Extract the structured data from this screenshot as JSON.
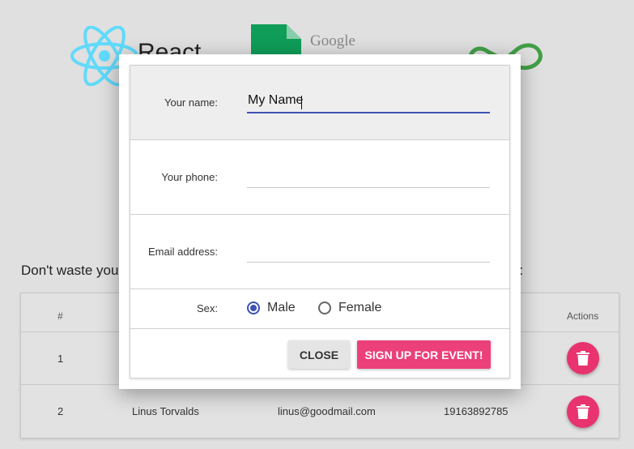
{
  "background": {
    "logos": {
      "react_text": "React",
      "google_text": "Google"
    },
    "intro_text_left": "Don't waste you",
    "intro_text_right": "n:",
    "table": {
      "headers": {
        "number": "#",
        "actions": "Actions"
      },
      "rows": [
        {
          "number": "1",
          "name": "",
          "email": "",
          "phone": ""
        },
        {
          "number": "2",
          "name": "Linus Torvalds",
          "email": "linus@goodmail.com",
          "phone": "19163892785"
        }
      ]
    },
    "delete_icon": "trash-icon"
  },
  "dialog": {
    "fields": {
      "name": {
        "label": "Your name:",
        "value": "My Name",
        "placeholder": ""
      },
      "phone": {
        "label": "Your phone:",
        "value": "",
        "placeholder": ""
      },
      "email": {
        "label": "Email address:",
        "value": "",
        "placeholder": ""
      }
    },
    "sex": {
      "label": "Sex:",
      "options": [
        "Male",
        "Female"
      ],
      "selected": "Male"
    },
    "buttons": {
      "close": "CLOSE",
      "signup": "SIGN UP FOR EVENT!"
    }
  },
  "colors": {
    "accent_pink": "#ec407a",
    "primary_indigo": "#3f51b5",
    "react_blue": "#61dafb",
    "sheets_green": "#0f9d58",
    "infinity_green": "#43a047"
  }
}
